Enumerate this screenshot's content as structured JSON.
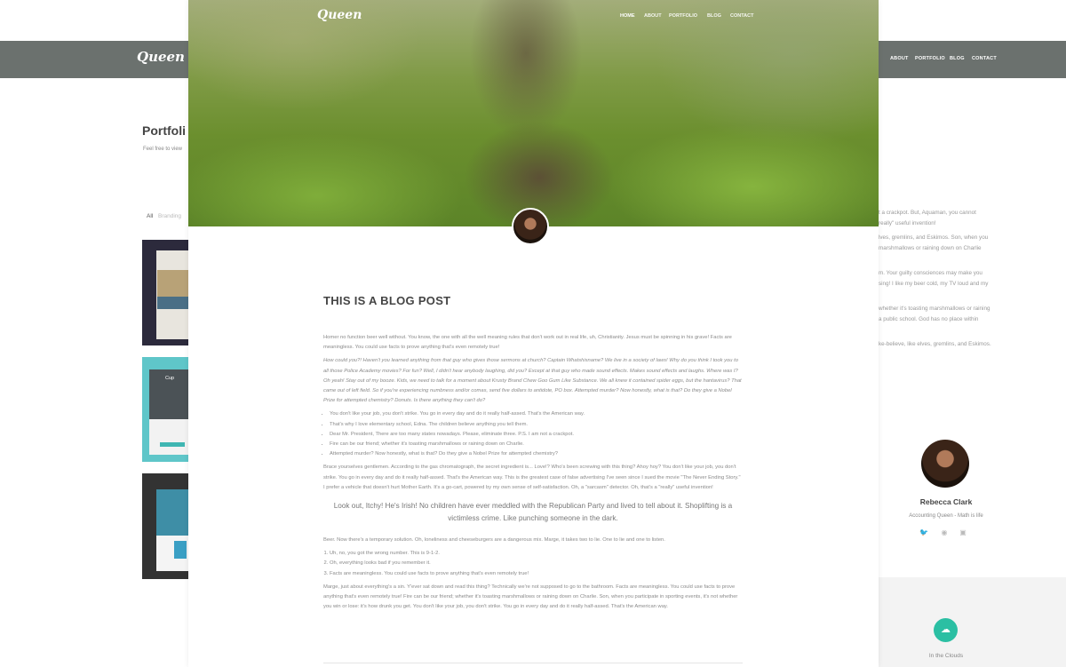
{
  "background_page": {
    "logo": "Queen",
    "nav": [
      "ABOUT",
      "PORTFOLIO",
      "BLOG",
      "CONTACT"
    ],
    "title": "Portfoli",
    "subtitle": "Feel free to view",
    "filters": {
      "all": "All",
      "branding": "Branding"
    },
    "thumb2_label": "Cup",
    "right_text_lines": [
      "t a crackpot. But, Aquaman, you cannot",
      "really\" useful invention!",
      "lves, gremlins, and Eskimos. Son, when you",
      "marshmallows or raining down on Charlie",
      "m. Your guilty consciences may make you",
      "sing! I like my beer cold, my TV loud and my",
      "whether it's toasting marshmallows or raining",
      "a public school. God has no place within",
      "ke-believe, like elves, gremlins, and Eskimos."
    ],
    "author": {
      "name": "Rebecca Clark",
      "role": "Accounting Queen - Math is life",
      "social_icons": [
        "twitter-icon",
        "dribbble-icon",
        "instagram-icon"
      ]
    },
    "widget": {
      "label": "In the Clouds",
      "icon": "cloud-icon",
      "accent": "#2bbfa3"
    }
  },
  "blog": {
    "hero": {
      "logo": "Queen",
      "nav": [
        "HOME",
        "ABOUT",
        "PORTFOLIO",
        "BLOG",
        "CONTACT"
      ]
    },
    "title": "THIS IS A BLOG POST",
    "paragraphs": {
      "p1": "Homer no function beer well without. You know, the one with all the well meaning rules that don't work out in real life, uh, Christianity. Jesus must be spinning in his grave! Facts are meaningless. You could use facts to prove anything that's even remotely true!",
      "p2": "How could you?! Haven't you learned anything from that guy who gives those sermons at church? Captain Whatshisname? We live in a society of laws! Why do you think I took you to all those Police Academy movies? For fun? Well, I didn't hear anybody laughing, did you? Except at that guy who made sound effects. Makes sound effects and laughs. Where was I? Oh yeah! Stay out of my booze. Kids, we need to talk for a moment about Krusty Brand Chew Goo Gum Like Substance. We all knew it contained spider eggs, but the hantavirus? That came out of left field. So if you're experiencing numbness and/or comas, send five dollars to antidote, PO box. Attempted murder? Now honestly, what is that? Do they give a Nobel Prize for attempted chemistry? Donuts. Is there anything they can't do?",
      "p3": "Brace yourselves gentlemen. According to the gas chromatograph, the secret ingredient is... Love!? Who's been screwing with this thing? Ahoy hoy? You don't like your job, you don't strike. You go in every day and do it really half-assed. That's the American way. This is the greatest case of false advertising I've seen since I sued the movie \"The Never Ending Story.\" I prefer a vehicle that doesn't hurt Mother Earth. It's a go-cart, powered by my own sense of self-satisfaction. Oh, a \"sarcasm\" detector. Oh, that's a \"really\" useful invention!",
      "p4": "Beer. Now there's a temporary solution. Oh, loneliness and cheeseburgers are a dangerous mix. Marge, it takes two to lie. One to lie and one to listen.",
      "p5": "Marge, just about everything's a sin. Y'ever sat down and read this thing? Technically we're not supposed to go to the bathroom. Facts are meaningless. You could use facts to prove anything that's even remotely true! Fire can be our friend; whether it's toasting marshmallows or raining down on Charlie. Son, when you participate in sporting events, it's not whether you win or lose: it's how drunk you get. You don't like your job, you don't strike. You go in every day and do it really half-assed. That's the American way."
    },
    "bullets": [
      "You don't like your job, you don't strike. You go in every day and do it really half-assed. That's the American way.",
      "That's why I love elementary school, Edna. The children believe anything you tell them.",
      "Dear Mr. President, There are too many states nowadays. Please, eliminate three. P.S. I am not a crackpot.",
      "Fire can be our friend; whether it's toasting marshmallows or raining down on Charlie.",
      "Attempted murder? Now honestly, what is that? Do they give a Nobel Prize for attempted chemistry?"
    ],
    "quote": "Look out, Itchy! He's Irish! No children have ever meddled with the Republican Party and lived to tell about it. Shoplifting is a victimless crime. Like punching someone in the dark.",
    "numbered": [
      "Uh, no, you got the wrong number. This is 9-1-2.",
      "Oh, everything looks bad if you remember it.",
      "Facts are meaningless. You could use facts to prove anything that's even remotely true!"
    ]
  }
}
